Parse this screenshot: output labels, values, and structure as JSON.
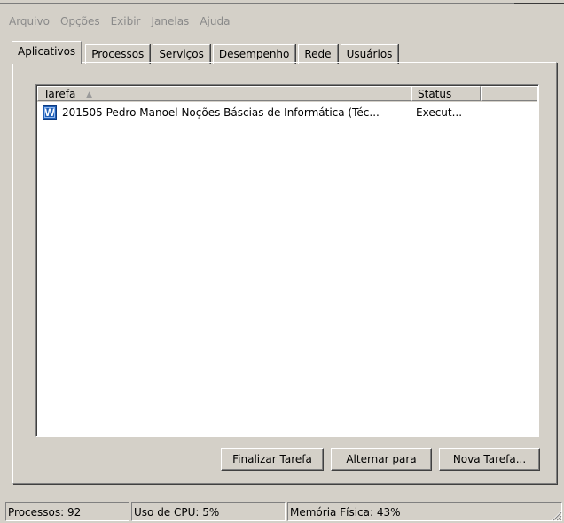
{
  "menu": [
    "Arquivo",
    "Opções",
    "Exibir",
    "Janelas",
    "Ajuda"
  ],
  "tabs": [
    {
      "label": "Aplicativos",
      "active": true
    },
    {
      "label": "Processos"
    },
    {
      "label": "Serviços"
    },
    {
      "label": "Desempenho"
    },
    {
      "label": "Rede"
    },
    {
      "label": "Usuários"
    }
  ],
  "list": {
    "columns": {
      "task": "Tarefa",
      "status": "Status"
    },
    "rows": [
      {
        "icon": "word-icon",
        "icon_letter": "W",
        "task": "201505 Pedro Manoel Noções Báscias de Informática (Téc...",
        "status": "Execut..."
      }
    ]
  },
  "buttons": {
    "end_task": "Finalizar Tarefa",
    "switch_to": "Alternar para",
    "new_task": "Nova Tarefa..."
  },
  "statusbar": {
    "processes": "Processos: 92",
    "cpu": "Uso de CPU: 5%",
    "memory": "Memória Física: 43%"
  }
}
